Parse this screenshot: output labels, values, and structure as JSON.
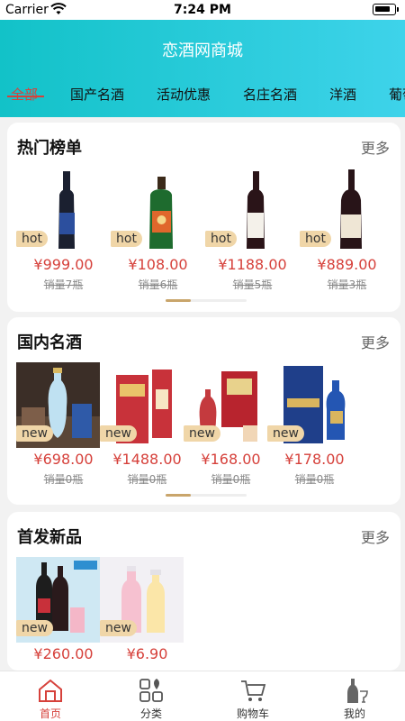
{
  "status": {
    "carrier": "Carrier",
    "time": "7:24 PM"
  },
  "header": {
    "title": "恋酒网商城"
  },
  "tabs": [
    "全部",
    "国产名酒",
    "活动优惠",
    "名庄名酒",
    "洋酒",
    "葡萄"
  ],
  "colors": {
    "accent": "#d6413b",
    "header_start": "#12c2c8",
    "header_end": "#3ed3ea",
    "badge": "#f0d6a8"
  },
  "hot": {
    "title": "热门榜单",
    "more": "更多",
    "items": [
      {
        "badge": "hot",
        "price": "¥999.00",
        "sold": "销量7瓶"
      },
      {
        "badge": "hot",
        "price": "¥108.00",
        "sold": "销量6瓶"
      },
      {
        "badge": "hot",
        "price": "¥1188.00",
        "sold": "销量5瓶"
      },
      {
        "badge": "hot",
        "price": "¥889.00",
        "sold": "销量3瓶"
      }
    ]
  },
  "domestic": {
    "title": "国内名酒",
    "more": "更多",
    "items": [
      {
        "badge": "new",
        "price": "¥698.00",
        "sold": "销量0瓶"
      },
      {
        "badge": "new",
        "price": "¥1488.00",
        "sold": "销量0瓶"
      },
      {
        "badge": "new",
        "price": "¥168.00",
        "sold": "销量0瓶"
      },
      {
        "badge": "new",
        "price": "¥178.00",
        "sold": "销量0瓶"
      }
    ]
  },
  "newarrivals": {
    "title": "首发新品",
    "more": "更多",
    "items": [
      {
        "badge": "new",
        "price": "¥260.00"
      },
      {
        "badge": "new",
        "price": "¥6.90"
      }
    ]
  },
  "tabbar": [
    {
      "label": "首页",
      "icon": "home-icon"
    },
    {
      "label": "分类",
      "icon": "category-icon"
    },
    {
      "label": "购物车",
      "icon": "cart-icon"
    },
    {
      "label": "我的",
      "icon": "profile-icon"
    }
  ]
}
